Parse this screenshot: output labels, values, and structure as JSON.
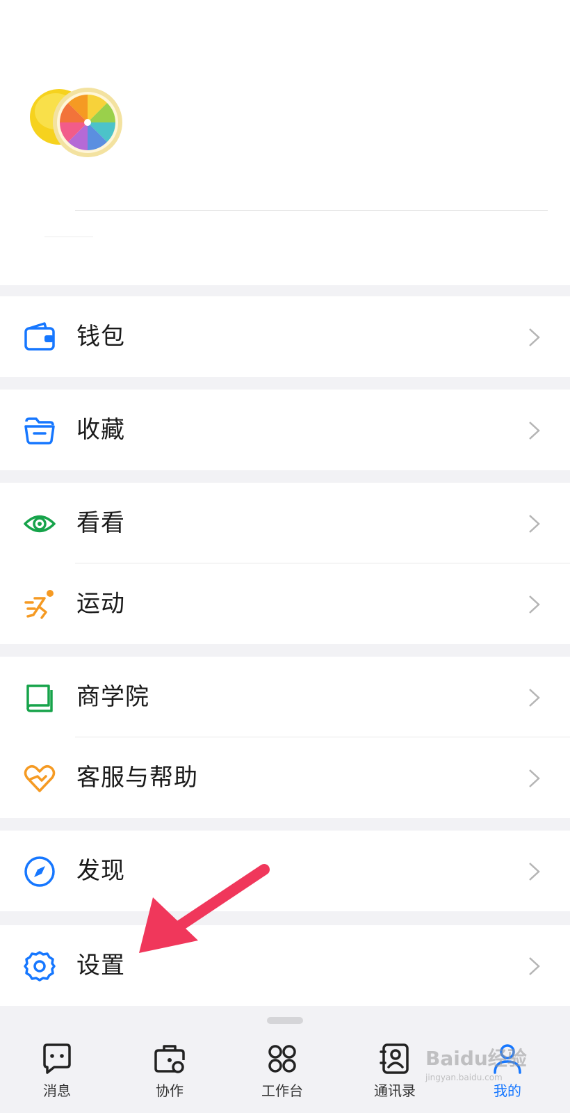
{
  "colors": {
    "blue": "#1677ff",
    "green": "#16a34a",
    "orange": "#f59a23",
    "arrow": "#f0375b",
    "text": "#1a1a1a"
  },
  "menu": {
    "wallet": {
      "label": "钱包",
      "icon": "wallet-icon"
    },
    "favorites": {
      "label": "收藏",
      "icon": "folder-icon"
    },
    "watch": {
      "label": "看看",
      "icon": "eye-icon"
    },
    "sports": {
      "label": "运动",
      "icon": "running-icon"
    },
    "business_school": {
      "label": "商学院",
      "icon": "book-icon"
    },
    "help": {
      "label": "客服与帮助",
      "icon": "heart-hand-icon"
    },
    "discover": {
      "label": "发现",
      "icon": "compass-icon"
    },
    "settings": {
      "label": "设置",
      "icon": "gear-icon"
    }
  },
  "tabbar": {
    "tabs": [
      {
        "label": "消息",
        "icon": "chat-icon",
        "active": false
      },
      {
        "label": "协作",
        "icon": "briefcase-icon",
        "active": false
      },
      {
        "label": "工作台",
        "icon": "grid-icon",
        "active": false
      },
      {
        "label": "通讯录",
        "icon": "contacts-icon",
        "active": false
      },
      {
        "label": "我的",
        "icon": "person-icon",
        "active": true
      }
    ]
  },
  "watermark": {
    "brand": "Baidu经验",
    "sub": "jingyan.baidu.com"
  }
}
